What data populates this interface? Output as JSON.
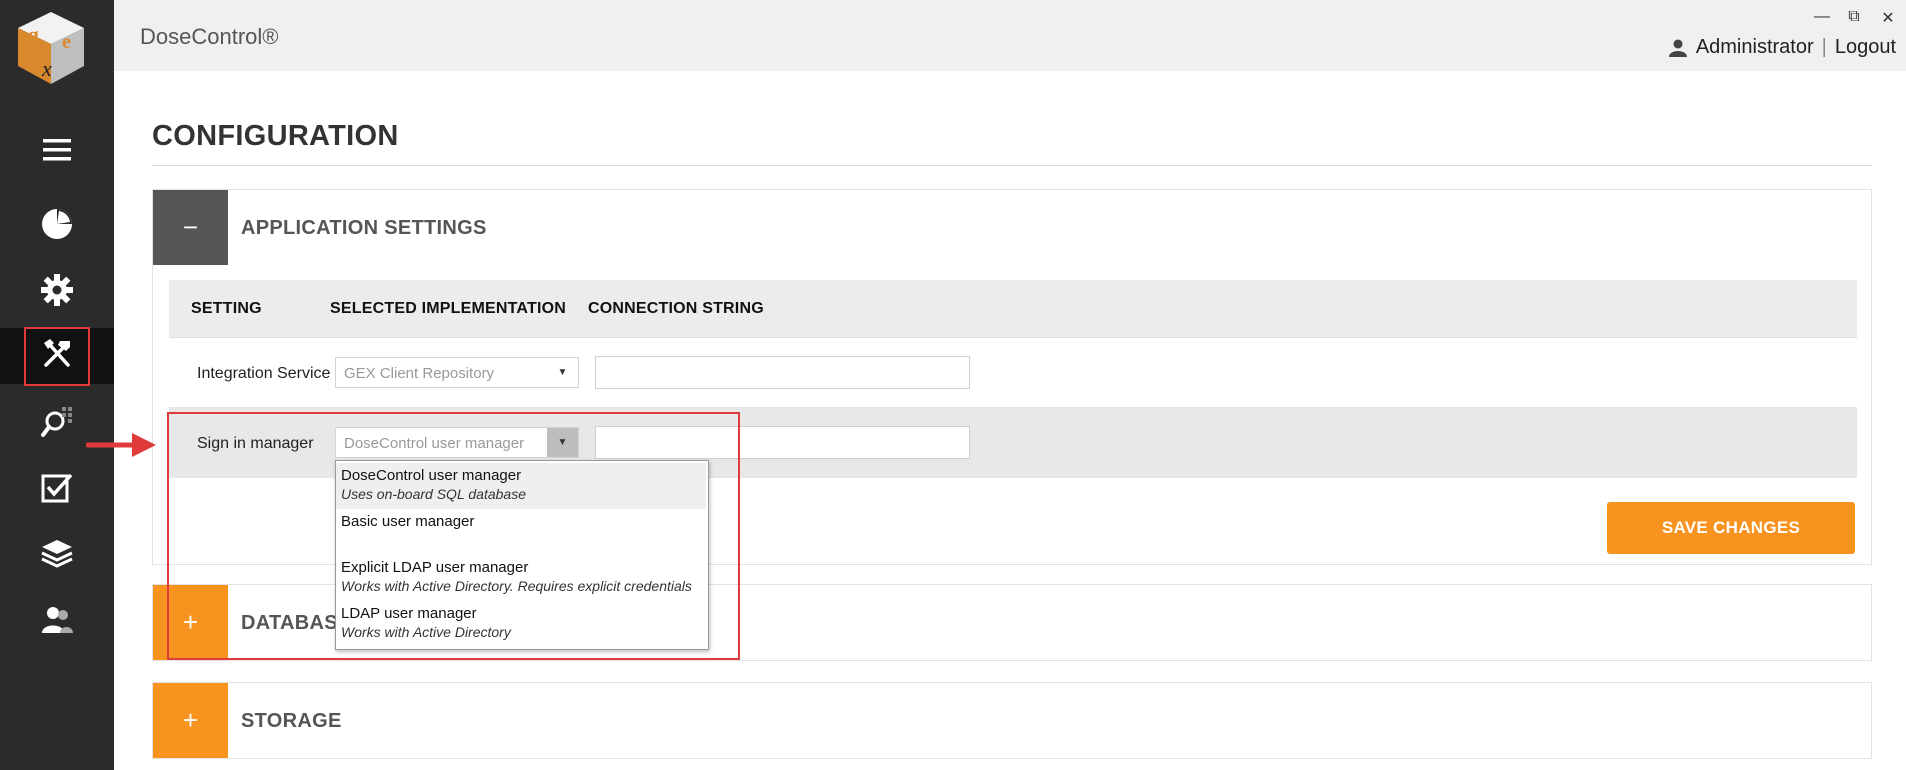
{
  "app": {
    "title": "DoseControl®"
  },
  "window": {
    "minimize": "—",
    "restore": "⧉",
    "close": "✕"
  },
  "user": {
    "name": "Administrator",
    "separator": "|",
    "logout": "Logout"
  },
  "page": {
    "title": "CONFIGURATION"
  },
  "panels": {
    "application": {
      "toggle": "−",
      "title": "APPLICATION SETTINGS",
      "columns": [
        "SETTING",
        "SELECTED IMPLEMENTATION",
        "CONNECTION STRING"
      ],
      "rows": [
        {
          "setting": "Integration Service",
          "implementation": "GEX Client Repository",
          "connection": ""
        },
        {
          "setting": "Sign in manager",
          "implementation": "DoseControl user manager",
          "connection": ""
        }
      ],
      "save_label": "SAVE CHANGES"
    },
    "database": {
      "toggle": "+",
      "title": "DATABAS"
    },
    "storage": {
      "toggle": "+",
      "title": "STORAGE"
    }
  },
  "dropdown": {
    "options": [
      {
        "name": "DoseControl user manager",
        "desc": "Uses on-board SQL database"
      },
      {
        "name": "Basic user manager",
        "desc": ""
      },
      {
        "name": "Explicit LDAP user manager",
        "desc": "Works with Active Directory. Requires explicit credentials"
      },
      {
        "name": "LDAP user manager",
        "desc": "Works with Active Directory"
      }
    ],
    "highlighted_index": 0
  },
  "colors": {
    "accent": "#f7931e",
    "sidebar": "#2b2b2b",
    "annotation": "#e03b3b"
  },
  "sidebar_icons": [
    "menu-icon",
    "dashboard-icon",
    "settings-icon",
    "tools-icon",
    "search-icon",
    "checklist-icon",
    "layers-icon",
    "users-icon"
  ]
}
